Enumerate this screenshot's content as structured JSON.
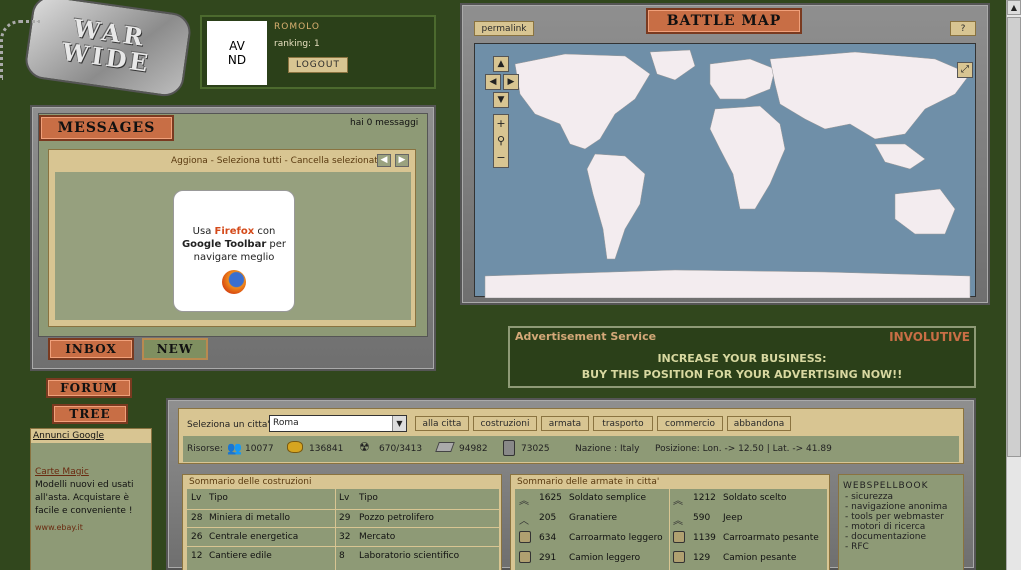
{
  "logo": {
    "line1": "WAR",
    "line2": "WIDE"
  },
  "user": {
    "avatar_text": "AV\nND",
    "avatar_line1": "AV",
    "avatar_line2": "ND",
    "name": "ROMOLO",
    "ranking": "ranking: 1",
    "logout": "LOGOUT"
  },
  "messages": {
    "title": "MESSAGES",
    "count": "hai 0 messaggi",
    "actions": {
      "refresh": "Aggiona",
      "sep1": " - ",
      "select_all": "Seleziona tutti",
      "sep2": " - ",
      "delete": "Cancella selezionati"
    },
    "ad": {
      "line1_a": "Usa ",
      "firefox": "Firefox",
      "line1_b": " con",
      "line2": "Google Toolbar",
      "line2_b": " per",
      "line3": "navigare meglio"
    },
    "inbox": "INBOX",
    "new": "NEW"
  },
  "nav": {
    "forum": "FORUM",
    "tree": "TREE"
  },
  "map": {
    "title": "BATTLE MAP",
    "permalink": "permalink",
    "help": "?"
  },
  "adservice": {
    "title": "Advertisement Service",
    "brand": "INVOLUTIVE",
    "line1": "INCREASE YOUR BUSINESS:",
    "line2": "BUY THIS POSITION FOR YOUR ADVERTISING NOW!!"
  },
  "sidebar_ads": {
    "header": "Annunci Google",
    "title": "Carte Magic",
    "body": "Modelli nuovi ed usati all'asta. Acquistare è facile e conveniente !",
    "url": "www.ebay.it"
  },
  "city": {
    "label": "Seleziona un citta':",
    "selected": "Roma",
    "buttons": [
      "alla citta",
      "costruzioni",
      "armata",
      "trasporto",
      "commercio",
      "abbandona"
    ]
  },
  "resources": {
    "label": "Risorse:",
    "values": [
      "10077",
      "136841",
      "670/3413",
      "94982",
      "73025"
    ],
    "nation": "Nazione : Italy",
    "position": "Posizione: Lon. -> 12.50 | Lat. -> 41.89"
  },
  "buildings": {
    "title": "Sommario delle costruzioni",
    "headers": [
      "Lv",
      "Tipo",
      "Lv",
      "Tipo"
    ],
    "rows": [
      [
        "28",
        "Miniera di metallo",
        "29",
        "Pozzo petrolifero"
      ],
      [
        "26",
        "Centrale energetica",
        "32",
        "Mercato"
      ],
      [
        "12",
        "Cantiere edile",
        "8",
        "Laboratorio scientifico"
      ]
    ]
  },
  "armies": {
    "title": "Sommario delle armate in citta'",
    "rows": [
      [
        "1625",
        "Soldato semplice",
        "1212",
        "Soldato scelto"
      ],
      [
        "205",
        "Granatiere",
        "590",
        "Jeep"
      ],
      [
        "634",
        "Carroarmato leggero",
        "1139",
        "Carroarmato pesante"
      ],
      [
        "291",
        "Camion leggero",
        "129",
        "Camion pesante"
      ]
    ]
  },
  "webspell": {
    "title": "WEBSPELLBOOK",
    "items": [
      "- sicurezza",
      "- navigazione anonima",
      "- tools per webmaster",
      "- motori di ricerca",
      "- documentazione",
      "- RFC"
    ]
  }
}
